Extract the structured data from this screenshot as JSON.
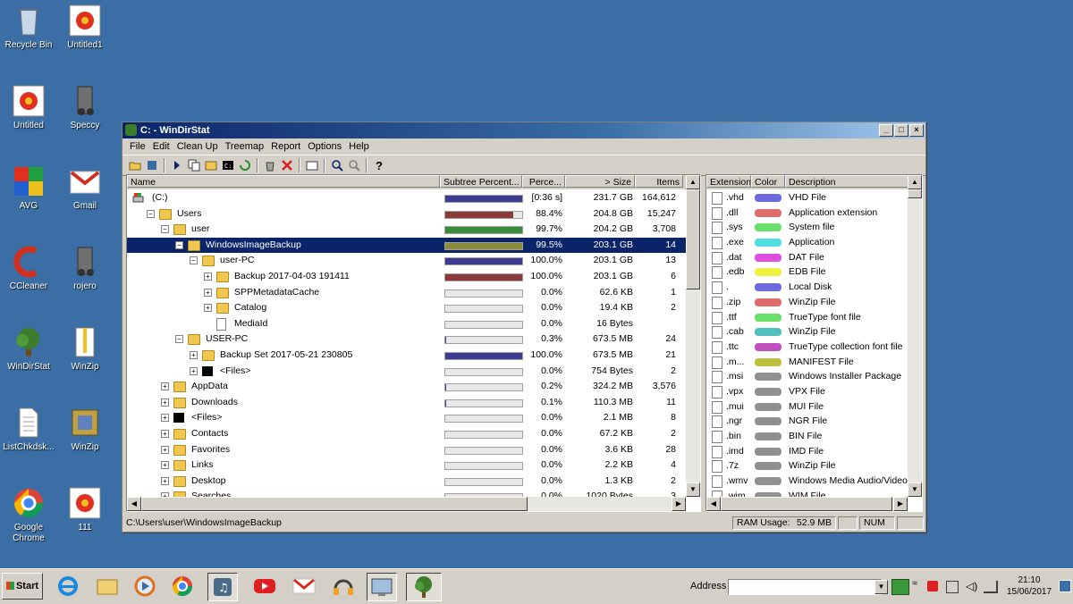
{
  "desktop": {
    "icons": [
      {
        "label": "Recycle Bin"
      },
      {
        "label": "Untitled1"
      },
      {
        "label": "Untitled"
      },
      {
        "label": "Speccy"
      },
      {
        "label": "AVG"
      },
      {
        "label": "Gmail"
      },
      {
        "label": "CCleaner"
      },
      {
        "label": "rojero"
      },
      {
        "label": "WinDirStat"
      },
      {
        "label": "WinZip"
      },
      {
        "label": "ListChkdsk..."
      },
      {
        "label": "WinZip"
      },
      {
        "label": "Google Chrome"
      },
      {
        "label": "111"
      }
    ]
  },
  "window": {
    "title": "C: - WinDirStat",
    "menu": [
      "File",
      "Edit",
      "Clean Up",
      "Treemap",
      "Report",
      "Options",
      "Help"
    ],
    "tree": {
      "columns": [
        "Name",
        "Subtree Percent...",
        "Perce...",
        "> Size",
        "Items"
      ],
      "rows": [
        {
          "name": "(C:)",
          "perc": "[0:36 s]",
          "size": "231.7 GB",
          "items": "164,612",
          "fill": 1.0,
          "color": "#3b3b8f",
          "indent": 0
        },
        {
          "name": "Users",
          "perc": "88.4%",
          "size": "204.8 GB",
          "items": "15,247",
          "fill": 0.884,
          "color": "#8b3a3a",
          "indent": 1
        },
        {
          "name": "user",
          "perc": "99.7%",
          "size": "204.2 GB",
          "items": "3,708",
          "fill": 0.997,
          "color": "#3a8b3a",
          "indent": 2
        },
        {
          "name": "WindowsImageBackup",
          "perc": "99.5%",
          "size": "203.1 GB",
          "items": "14",
          "fill": 0.995,
          "color": "#8b8b3a",
          "indent": 3,
          "selected": true
        },
        {
          "name": "user-PC",
          "perc": "100.0%",
          "size": "203.1 GB",
          "items": "13",
          "fill": 1.0,
          "color": "#3b3b8f",
          "indent": 4
        },
        {
          "name": "Backup 2017-04-03 191411",
          "perc": "100.0%",
          "size": "203.1 GB",
          "items": "6",
          "fill": 1.0,
          "color": "#8b3a3a",
          "indent": 5
        },
        {
          "name": "SPPMetadataCache",
          "perc": "0.0%",
          "size": "62.6 KB",
          "items": "1",
          "fill": 0,
          "color": "#3a8b3a",
          "indent": 5
        },
        {
          "name": "Catalog",
          "perc": "0.0%",
          "size": "19.4 KB",
          "items": "2",
          "fill": 0,
          "color": "#3a8b3a",
          "indent": 5
        },
        {
          "name": "MediaId",
          "perc": "0.0%",
          "size": "16 Bytes",
          "items": "",
          "fill": 0,
          "color": "#3a8b3a",
          "indent": 5
        },
        {
          "name": "USER-PC",
          "perc": "0.3%",
          "size": "673.5 MB",
          "items": "24",
          "fill": 0.003,
          "color": "#3b3b8f",
          "indent": 3
        },
        {
          "name": "Backup Set 2017-05-21 230805",
          "perc": "100.0%",
          "size": "673.5 MB",
          "items": "21",
          "fill": 1.0,
          "color": "#3b3b8f",
          "indent": 4
        },
        {
          "name": "<Files>",
          "perc": "0.0%",
          "size": "754 Bytes",
          "items": "2",
          "fill": 0,
          "color": "#3b3b8f",
          "indent": 4
        },
        {
          "name": "AppData",
          "perc": "0.2%",
          "size": "324.2 MB",
          "items": "3,576",
          "fill": 0.002,
          "color": "#3b3b8f",
          "indent": 2
        },
        {
          "name": "Downloads",
          "perc": "0.1%",
          "size": "110.3 MB",
          "items": "11",
          "fill": 0.001,
          "color": "#3b3b8f",
          "indent": 2
        },
        {
          "name": "<Files>",
          "perc": "0.0%",
          "size": "2.1 MB",
          "items": "8",
          "fill": 0,
          "color": "#3b3b8f",
          "indent": 2
        },
        {
          "name": "Contacts",
          "perc": "0.0%",
          "size": "67.2 KB",
          "items": "2",
          "fill": 0,
          "color": "#3b3b8f",
          "indent": 2
        },
        {
          "name": "Favorites",
          "perc": "0.0%",
          "size": "3.6 KB",
          "items": "28",
          "fill": 0,
          "color": "#3b3b8f",
          "indent": 2
        },
        {
          "name": "Links",
          "perc": "0.0%",
          "size": "2.2 KB",
          "items": "4",
          "fill": 0,
          "color": "#3b3b8f",
          "indent": 2
        },
        {
          "name": "Desktop",
          "perc": "0.0%",
          "size": "1.3 KB",
          "items": "2",
          "fill": 0,
          "color": "#3b3b8f",
          "indent": 2
        },
        {
          "name": "Searches",
          "perc": "0.0%",
          "size": "1020 Bytes",
          "items": "3",
          "fill": 0,
          "color": "#3b3b8f",
          "indent": 2
        }
      ]
    },
    "extensions": {
      "columns": [
        "Extension",
        "Color",
        "Description"
      ],
      "rows": [
        {
          "ext": ".vhd",
          "color": "#6b6bdf",
          "desc": "VHD File"
        },
        {
          "ext": ".dll",
          "color": "#e06b6b",
          "desc": "Application extension"
        },
        {
          "ext": ".sys",
          "color": "#6bdf6b",
          "desc": "System file"
        },
        {
          "ext": ".exe",
          "color": "#4fdfdf",
          "desc": "Application"
        },
        {
          "ext": ".dat",
          "color": "#df4fdf",
          "desc": "DAT File"
        },
        {
          "ext": ".edb",
          "color": "#efef3f",
          "desc": "EDB File"
        },
        {
          "ext": ".",
          "color": "#6b6bdf",
          "desc": "Local Disk"
        },
        {
          "ext": ".zip",
          "color": "#e06b6b",
          "desc": "WinZip File"
        },
        {
          "ext": ".ttf",
          "color": "#6bdf6b",
          "desc": "TrueType font file"
        },
        {
          "ext": ".cab",
          "color": "#4fbfbf",
          "desc": "WinZip File"
        },
        {
          "ext": ".ttc",
          "color": "#bf4fbf",
          "desc": "TrueType collection font file"
        },
        {
          "ext": ".m...",
          "color": "#bfbf3f",
          "desc": "MANIFEST File"
        },
        {
          "ext": ".msi",
          "color": "#909090",
          "desc": "Windows Installer Package"
        },
        {
          "ext": ".vpx",
          "color": "#909090",
          "desc": "VPX File"
        },
        {
          "ext": ".mui",
          "color": "#909090",
          "desc": "MUI File"
        },
        {
          "ext": ".ngr",
          "color": "#909090",
          "desc": "NGR File"
        },
        {
          "ext": ".bin",
          "color": "#909090",
          "desc": "BIN File"
        },
        {
          "ext": ".imd",
          "color": "#909090",
          "desc": "IMD File"
        },
        {
          "ext": ".7z",
          "color": "#909090",
          "desc": "WinZip File"
        },
        {
          "ext": ".wmv",
          "color": "#909090",
          "desc": "Windows Media Audio/Video file"
        },
        {
          "ext": ".wim",
          "color": "#909090",
          "desc": "WIM File"
        }
      ]
    },
    "status": {
      "path": "C:\\Users\\user\\WindowsImageBackup",
      "ram_label": "RAM Usage:",
      "ram_value": "52.9 MB",
      "num": "NUM"
    }
  },
  "taskbar": {
    "start": "Start",
    "address_label": "Address",
    "clock_time": "21:10",
    "clock_date": "15/06/2017"
  }
}
